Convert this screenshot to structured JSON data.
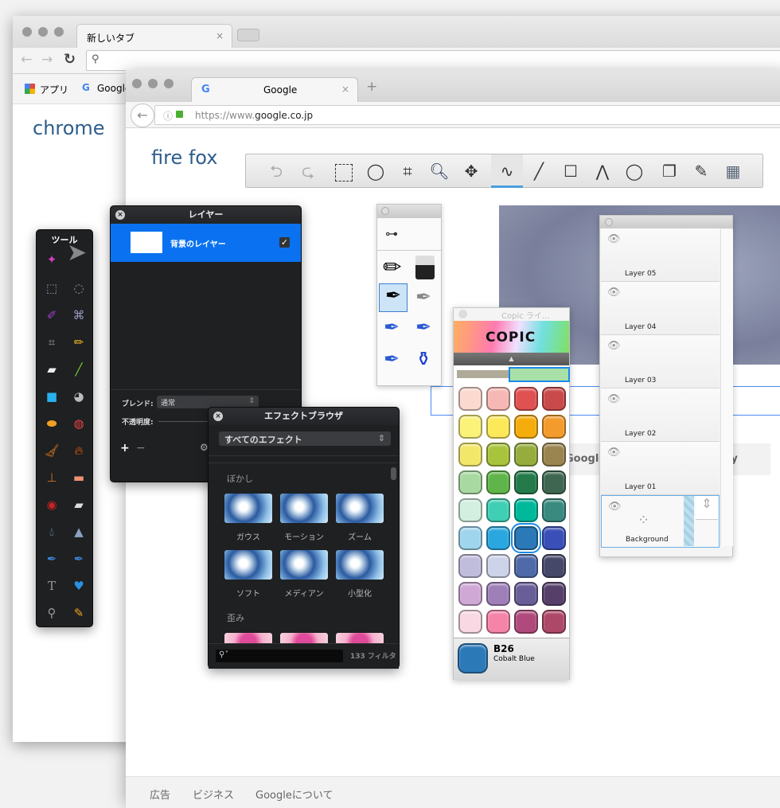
{
  "chrome": {
    "tab_title": "新しいタブ",
    "tab_close": "×",
    "bookmarks": [
      {
        "label": "アプリ",
        "icon": "apps-grid-icon"
      },
      {
        "label": "Google",
        "icon": "google-icon"
      }
    ],
    "page_text": "chrome"
  },
  "firefox": {
    "tab_title": "Google",
    "tab_close": "×",
    "new_tab": "+",
    "url_prefix": "https://www.",
    "url_domain": "google.co.jp",
    "page_text": "fire fox",
    "footer": [
      "広告",
      "ビジネス",
      "Googleについて"
    ],
    "google_buttons": [
      "Google",
      "cky"
    ]
  },
  "tools_panel": {
    "title": "ツール"
  },
  "layer_panel": {
    "title": "レイヤー",
    "layer_name": "背景のレイヤー",
    "visible": true,
    "blend_label": "ブレンド:",
    "blend_value": "通常",
    "opacity_label": "不透明度:",
    "add": "+",
    "remove": "−"
  },
  "effects": {
    "title": "エフェクトブラウザ",
    "category": "すべてのエフェクト",
    "sections": [
      {
        "name": "ぼかし",
        "items": [
          "ガウス",
          "モーション",
          "ズーム",
          "ソフト",
          "メディアン",
          "小型化"
        ]
      },
      {
        "name": "歪み",
        "items": []
      }
    ],
    "count": "133 フィルタ"
  },
  "copic": {
    "title": "Copic ライ…",
    "logo": "COPIC",
    "selected_code": "B26",
    "selected_name": "Cobalt Blue",
    "selected_color": "#2c79b8",
    "swatches": [
      [
        "#fbd9cf",
        "#f6b8b4",
        "#e05252",
        "#c94a4a"
      ],
      [
        "#fbf27a",
        "#fce95a",
        "#f5ad0d",
        "#f39b2c"
      ],
      [
        "#f3e76a",
        "#a8c43c",
        "#96ad3e",
        "#9a8450"
      ],
      [
        "#a8d9a0",
        "#5fb54a",
        "#247a4a",
        "#3f6650"
      ],
      [
        "#d3efe0",
        "#3fcfb4",
        "#00b89a",
        "#3a8a80"
      ],
      [
        "#9fd6ee",
        "#2aa7df",
        "#2c79b8",
        "#3a50b8"
      ],
      [
        "#c0bcdc",
        "#cdd3e8",
        "#4f6aa8",
        "#454868"
      ],
      [
        "#cfa8d6",
        "#9e7fb8",
        "#6a5e98",
        "#56406a"
      ],
      [
        "#f9d8e4",
        "#f584a8",
        "#b04a7c",
        "#ae4868"
      ]
    ]
  },
  "layers": {
    "items": [
      "Layer 05",
      "Layer 04",
      "Layer 03",
      "Layer 02",
      "Layer 01",
      "Background"
    ],
    "selected": "Background"
  }
}
